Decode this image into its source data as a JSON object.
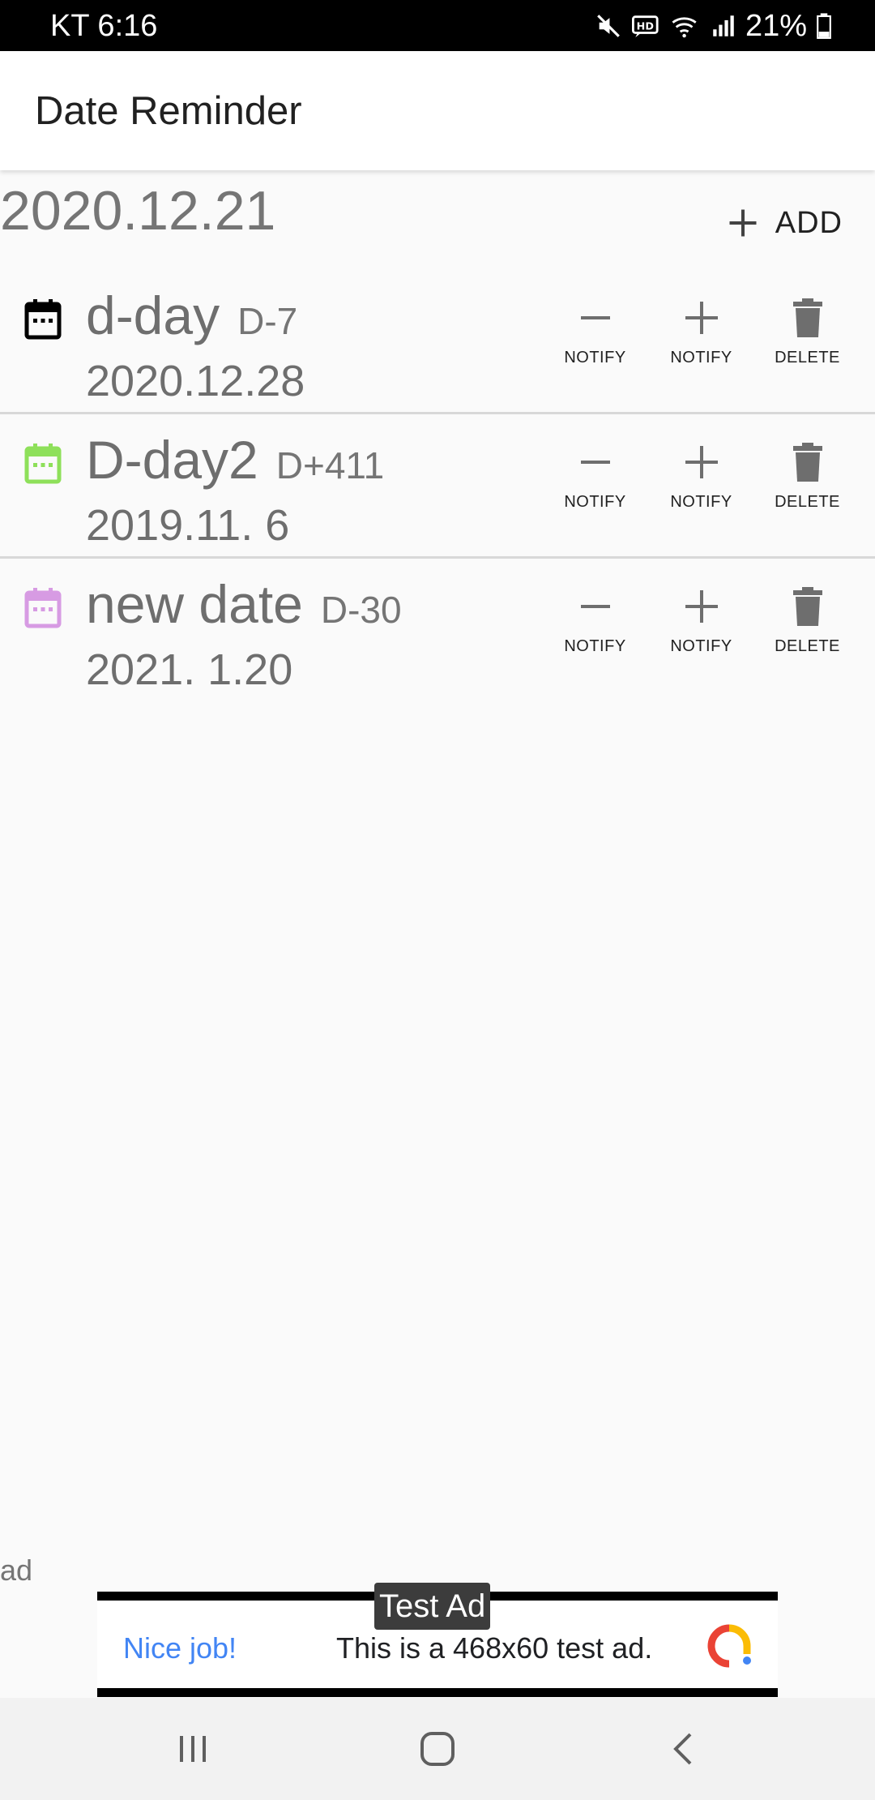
{
  "status_bar": {
    "carrier_time": "KT 6:16",
    "battery": "21%",
    "icons": [
      "mute-icon",
      "hd-icon",
      "wifi-icon",
      "signal-icon",
      "battery-icon"
    ]
  },
  "app_bar": {
    "title": "Date Reminder"
  },
  "header": {
    "today": "2020.12.21",
    "add_label": "ADD"
  },
  "events": [
    {
      "name": "d-day",
      "dday": "D-7",
      "date": "2020.12.28",
      "icon_color": "#000000",
      "actions": {
        "minus": "NOTIFY",
        "plus": "NOTIFY",
        "delete": "DELETE"
      }
    },
    {
      "name": "D-day2",
      "dday": "D+411",
      "date": "2019.11. 6",
      "icon_color": "#8ee05a",
      "actions": {
        "minus": "NOTIFY",
        "plus": "NOTIFY",
        "delete": "DELETE"
      }
    },
    {
      "name": "new date",
      "dday": "D-30",
      "date": "2021. 1.20",
      "icon_color": "#d79be3",
      "actions": {
        "minus": "NOTIFY",
        "plus": "NOTIFY",
        "delete": "DELETE"
      }
    }
  ],
  "ad": {
    "label": "ad",
    "tag": "Test Ad",
    "headline": "Nice job!",
    "text": "This is a 468x60 test ad."
  },
  "colors": {
    "accent_text": "#212121",
    "secondary_text": "#6e6e6e",
    "ad_link": "#4285f4"
  }
}
